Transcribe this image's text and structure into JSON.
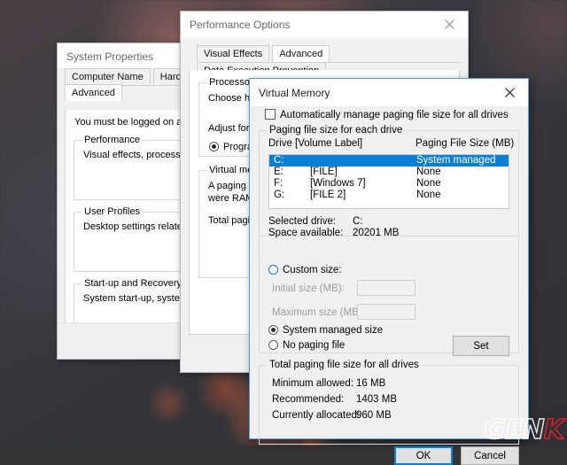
{
  "desktop": {
    "watermark": "GEN",
    "watermark_accent": "K"
  },
  "system_properties": {
    "title": "System Properties",
    "close_icon": "close-icon",
    "tabs": [
      {
        "label": "Computer Name",
        "selected": false
      },
      {
        "label": "Hardware",
        "selected": false
      },
      {
        "label": "Advanced",
        "selected": true
      }
    ],
    "admin_note": "You must be logged on as an Adm",
    "groups": [
      {
        "title": "Performance",
        "text": "Visual effects, processor schedu"
      },
      {
        "title": "User Profiles",
        "text": "Desktop settings related to your"
      },
      {
        "title": "Start-up and Recovery",
        "text": "System start-up, system failure a"
      }
    ]
  },
  "performance_options": {
    "title": "Performance Options",
    "close_icon": "close-icon",
    "tabs": [
      {
        "label": "Visual Effects",
        "selected": false
      },
      {
        "label": "Advanced",
        "selected": true
      },
      {
        "label": "Data Execution Prevention",
        "selected": false
      }
    ],
    "processor_scheduling": {
      "group_title": "Processor scheduling",
      "description": "Choose how t",
      "adjust_label": "Adjust for bes",
      "option_label": "Programs",
      "option_checked": true
    },
    "virtual_memory": {
      "group_title": "Virtual memor",
      "line1": "A paging file",
      "line2": "were RAM.",
      "line3": "Total paging f"
    }
  },
  "virtual_memory_dialog": {
    "title": "Virtual Memory",
    "close_icon": "close-icon",
    "auto_manage": {
      "label": "Automatically manage paging file size for all drives",
      "checked": false
    },
    "paging_group_title": "Paging file size for each drive",
    "columns": {
      "drive": "Drive  [Volume Label]",
      "size": "Paging File Size (MB)"
    },
    "drives": [
      {
        "drive": "C:",
        "label": "",
        "size": "System managed",
        "selected": true
      },
      {
        "drive": "E:",
        "label": "[FILE]",
        "size": "None",
        "selected": false
      },
      {
        "drive": "F:",
        "label": "[Windows 7]",
        "size": "None",
        "selected": false
      },
      {
        "drive": "G:",
        "label": "[FILE 2]",
        "size": "None",
        "selected": false
      }
    ],
    "selected_drive_label": "Selected drive:",
    "selected_drive_value": "C:",
    "space_available_label": "Space available:",
    "space_available_value": "20201 MB",
    "custom_size": {
      "label": "Custom size:",
      "checked": false
    },
    "initial_size": {
      "label": "Initial size (MB):",
      "value": ""
    },
    "maximum_size": {
      "label": "Maximum size (MB):",
      "value": ""
    },
    "system_managed": {
      "label": "System managed size",
      "checked": true
    },
    "no_paging_file": {
      "label": "No paging file",
      "checked": false
    },
    "set_button": "Set",
    "total_group_title": "Total paging file size for all drives",
    "totals": [
      {
        "label": "Minimum allowed:",
        "value": "16 MB"
      },
      {
        "label": "Recommended:",
        "value": "1403 MB"
      },
      {
        "label": "Currently allocated:",
        "value": "960 MB"
      }
    ],
    "ok_button": "OK",
    "cancel_button": "Cancel",
    "accent_color": "#0a7fd4"
  }
}
